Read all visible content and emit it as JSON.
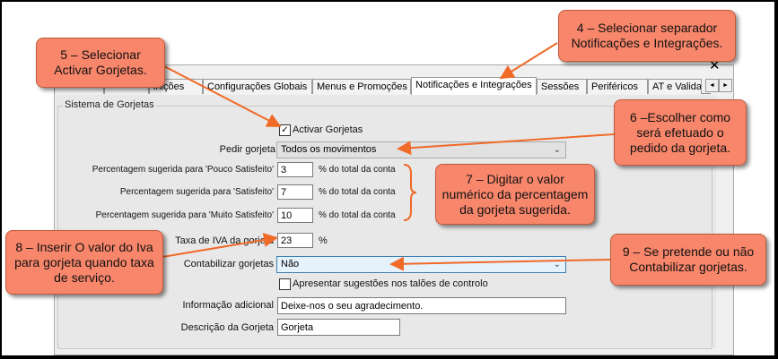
{
  "tabs": [
    {
      "label": "",
      "width": 56
    },
    {
      "label": "",
      "width": 50
    },
    {
      "label": "inições",
      "width": 60
    },
    {
      "label": "Configurações Globais",
      "width": 122
    },
    {
      "label": "Menus e Promoções",
      "width": 110
    },
    {
      "label": "Notificações e Integrações",
      "width": 140
    },
    {
      "label": "Sessões",
      "width": 56
    },
    {
      "label": "Periféricos",
      "width": 68
    },
    {
      "label": "AT e Valida",
      "width": 60
    }
  ],
  "window": {
    "close_label": "✕",
    "scroll_left": "◄",
    "scroll_right": "►"
  },
  "group_title": "Sistema de Gorjetas",
  "activar": {
    "label": "Activar Gorjetas",
    "checked": "✓"
  },
  "pedir": {
    "label": "Pedir gorjeta",
    "value": "Todos os movimentos"
  },
  "perc": {
    "pouco_label": "Percentagem sugerida para 'Pouco Satisfeito'",
    "pouco_value": "3",
    "satisfeito_label": "Percentagem sugerida para 'Satisfeito'",
    "satisfeito_value": "7",
    "muito_label": "Percentagem sugerida para 'Muito Satisfeito'",
    "muito_value": "10",
    "suffix": "% do total da conta"
  },
  "iva": {
    "label": "Taxa de IVA da gorjeta",
    "value": "23",
    "suffix": "%"
  },
  "contabilizar": {
    "label": "Contabilizar gorjetas",
    "value": "Não"
  },
  "apresentar": {
    "label": "Apresentar sugestões nos talões de controlo",
    "checked": ""
  },
  "info": {
    "label": "Informação adicional",
    "value": "Deixe-nos o seu agradecimento."
  },
  "desc": {
    "label": "Descrição da Gorjeta",
    "value": "Gorjeta"
  },
  "callouts": {
    "c4": "4 – Selecionar separador Notificações e Integrações.",
    "c5": "5 – Selecionar Activar Gorjetas.",
    "c6": "6 –Escolher como será efetuado o pedido da gorjeta.",
    "c7": "7 – Digitar o valor numérico da percentagem da gorjeta sugerida.",
    "c8": "8 – Inserir O valor do Iva para gorjeta quando taxa de serviço.",
    "c9": "9 – Se pretende ou não Contabilizar gorjetas."
  },
  "colors": {
    "callout": "#f8866b",
    "arrow": "#f06a28"
  }
}
